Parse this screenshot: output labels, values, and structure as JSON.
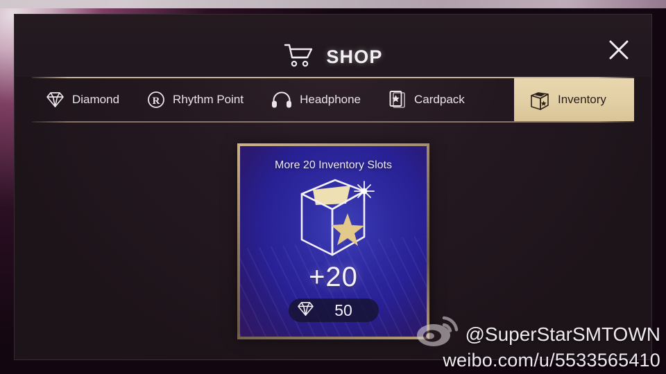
{
  "header": {
    "title": "SHOP",
    "cart_icon": "shopping-cart-icon",
    "close_icon": "close-x-icon"
  },
  "tabs": [
    {
      "label": "Diamond",
      "icon": "diamond-gem-icon",
      "active": false
    },
    {
      "label": "Rhythm Point",
      "icon": "circled-r-icon",
      "active": false
    },
    {
      "label": "Headphone",
      "icon": "headphone-icon",
      "active": false
    },
    {
      "label": "Cardpack",
      "icon": "cardpack-star-icon",
      "active": false
    },
    {
      "label": "Inventory",
      "icon": "inventory-box-icon",
      "active": true
    }
  ],
  "product": {
    "title": "More 20 Inventory Slots",
    "art_icon": "open-box-with-star-icon",
    "amount": "+20",
    "price_currency_icon": "diamond-gem-icon",
    "price_value": "50"
  },
  "watermark": {
    "logo_icon": "weibo-logo-icon",
    "handle": "@SuperStarSMTOWN",
    "url": "weibo.com/u/5533565410"
  },
  "colors": {
    "active_tab_bg": "#e2cfa5",
    "card_border": "#cdb389",
    "card_bg": "#2f2aa0",
    "panel_bg": "#221620",
    "accent_gold": "#e2cfa5",
    "text_light": "#efeaf4"
  }
}
